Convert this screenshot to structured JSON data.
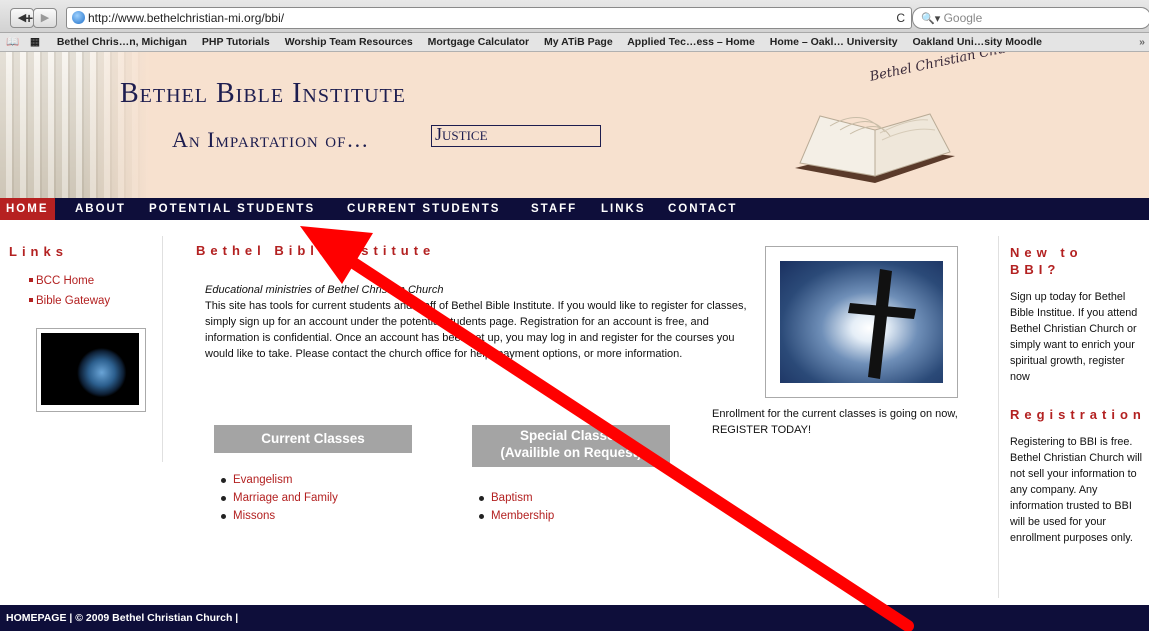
{
  "browser": {
    "back": "◀",
    "forward": "▶",
    "add": "+",
    "url": "http://www.bethelchristian-mi.org/bbi/",
    "reload": "C",
    "search_placeholder": "Google",
    "bookmarks": [
      "Bethel Chris…n, Michigan",
      "PHP Tutorials",
      "Worship Team Resources",
      "Mortgage Calculator",
      "My ATiB Page",
      "Applied Tec…ess – Home",
      "Home – Oakl… University",
      "Oakland Uni…sity Moodle"
    ],
    "overflow": "»"
  },
  "banner": {
    "title": "Bethel Bible Institute",
    "subtitle": "An Impartation of…",
    "box_text": "Justice",
    "church_script": "Bethel Christian Church"
  },
  "menu": [
    "HOME",
    "ABOUT",
    "POTENTIAL STUDENTS",
    "CURRENT STUDENTS",
    "STAFF",
    "LINKS",
    "CONTACT"
  ],
  "left": {
    "heading": "Links",
    "links": [
      "BCC Home",
      "Bible Gateway"
    ]
  },
  "main": {
    "title": "Bethel Bible Institute",
    "intro_italic": "Educational ministries of Bethel Christian Church",
    "intro_body": "This site has tools for current students and staff of Bethel Bible Institute. If you would like to register for classes, simply sign up for an account under the potential students page. Registration for an account is free, and information is confidential. Once an account has been set up, you may log in and register for the courses you would like to take. Please contact the church office for help, payment options, or more information.",
    "current_label": "Current Classes",
    "current_items": [
      "Evangelism",
      "Marriage and Family",
      "Missons"
    ],
    "special_label_1": "Special Classes",
    "special_label_2": "(Availible on Request)",
    "special_items": [
      "Baptism",
      "Membership"
    ],
    "enroll_text": "Enrollment for the current classes is going on now, REGISTER TODAY!"
  },
  "right": {
    "new_heading": "New to BBI?",
    "new_text": "Sign up today for Bethel Bible Institue. If you attend Bethel Christian Church or simply want to enrich your spiritual growth, register now",
    "reg_heading": "Registration",
    "reg_text": "Registering to BBI is free. Bethel Christian Church will not sell your information to any company. Any information trusted to BBI will be used for your enrollment purposes only."
  },
  "footer": "HOMEPAGE | © 2009 Bethel Christian Church |",
  "colors": {
    "accent": "#b32121",
    "nav": "#0e0e3a",
    "banner": "#f7e1cf",
    "annotation_arrow": "#ff0000"
  }
}
